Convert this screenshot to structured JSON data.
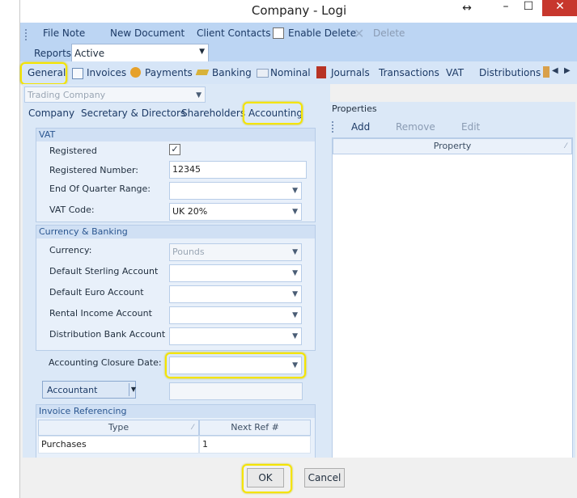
{
  "window": {
    "title": "Company - Logi"
  },
  "ribbon": {
    "items": [
      "File Note",
      "New Document",
      "Client Contacts"
    ],
    "enable_delete_label": "Enable Delete",
    "enable_delete_checked": false,
    "delete_label": "Delete",
    "reports_label": "Reports",
    "reports_value": "Active"
  },
  "tabs": [
    "General",
    "Invoices",
    "Payments",
    "Banking",
    "Nominal",
    "Journals",
    "Transactions",
    "VAT",
    "Distributions"
  ],
  "company_type": {
    "value": "Trading Company"
  },
  "subtabs": [
    "Company",
    "Secretary & Directors",
    "Shareholders",
    "Accounting"
  ],
  "vat": {
    "header": "VAT",
    "registered_label": "Registered",
    "registered_checked": true,
    "reg_number_label": "Registered Number:",
    "reg_number_value": "12345",
    "end_quarter_label": "End Of Quarter Range:",
    "end_quarter_value": "",
    "vat_code_label": "VAT Code:",
    "vat_code_value": "UK 20%"
  },
  "currency": {
    "header": "Currency & Banking",
    "currency_label": "Currency:",
    "currency_value": "Pounds",
    "sterling_label": "Default Sterling Account",
    "euro_label": "Default Euro Account",
    "rental_label": "Rental Income Account",
    "distribution_label": "Distribution Bank Account"
  },
  "closure": {
    "label": "Accounting Closure Date:",
    "value": ""
  },
  "accountant": {
    "label": "Accountant",
    "value": ""
  },
  "invoice_ref": {
    "header": "Invoice Referencing",
    "columns": [
      "Type",
      "Next Ref #"
    ],
    "rows": [
      {
        "type": "Purchases",
        "next": "1"
      }
    ]
  },
  "properties": {
    "header": "Properties",
    "add_label": "Add",
    "remove_label": "Remove",
    "edit_label": "Edit",
    "column": "Property"
  },
  "footer": {
    "ok_label": "OK",
    "cancel_label": "Cancel"
  }
}
